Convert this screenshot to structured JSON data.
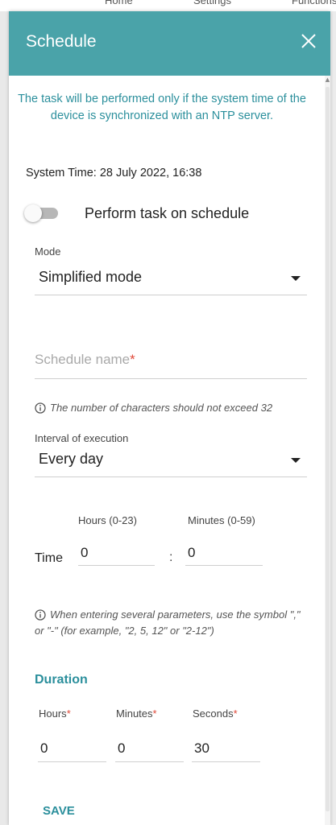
{
  "background_tabs": [
    "Home",
    "Settings",
    "Functions"
  ],
  "dialog": {
    "title": "Schedule",
    "close_icon": "close-icon"
  },
  "notice": "The task will be performed only if the system time of the device is synchronized with an NTP server.",
  "system_time": "System Time: 28 July 2022, 16:38",
  "perform_task": {
    "label": "Perform task on schedule",
    "enabled": false
  },
  "mode": {
    "label": "Mode",
    "value": "Simplified mode"
  },
  "schedule_name": {
    "placeholder": "Schedule name",
    "required_mark": "*",
    "value": ""
  },
  "name_hint": "The number of characters should not exceed 32",
  "interval": {
    "label": "Interval of execution",
    "value": "Every day"
  },
  "time": {
    "label": "Time",
    "hours_label": "Hours (0-23)",
    "minutes_label": "Minutes (0-59)",
    "separator": ":",
    "hours_value": "0",
    "minutes_value": "0"
  },
  "params_hint": "When entering several parameters, use the symbol \",\" or \"-\" (for example, \"2, 5, 12\" or \"2-12\")",
  "duration": {
    "title": "Duration",
    "hours_label": "Hours",
    "minutes_label": "Minutes",
    "seconds_label": "Seconds",
    "required_mark": "*",
    "hours_value": "0",
    "minutes_value": "0",
    "seconds_value": "30"
  },
  "save_label": "SAVE",
  "colors": {
    "header": "#4aa3a9",
    "accent": "#2b8f9c",
    "required": "#e04a3a"
  }
}
